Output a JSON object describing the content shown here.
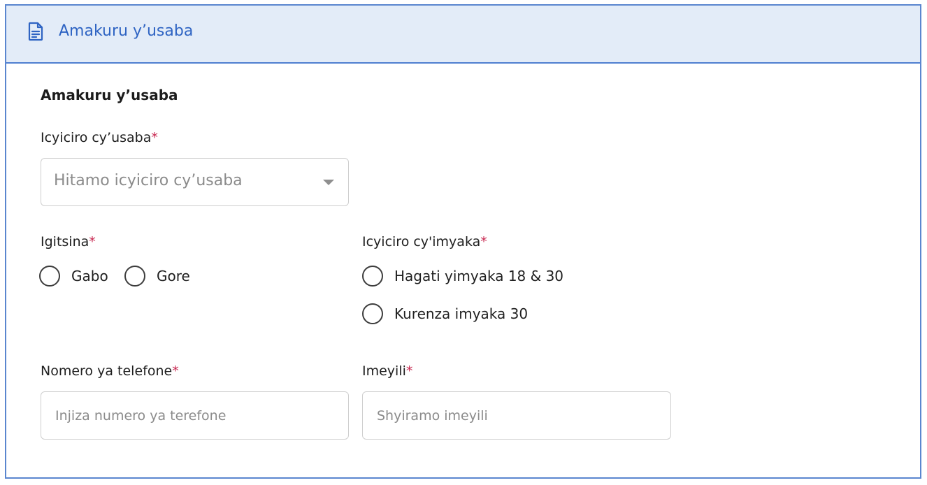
{
  "header": {
    "icon": "document-icon",
    "title": "Amakuru y’usaba"
  },
  "section": {
    "title": "Amakuru y’usaba"
  },
  "category": {
    "label": "Icyiciro cy’usaba",
    "required_mark": "*",
    "placeholder": "Hitamo icyiciro cy’usaba"
  },
  "gender": {
    "label": "Igitsina",
    "required_mark": "*",
    "options": [
      {
        "label": "Gabo",
        "selected": false
      },
      {
        "label": "Gore",
        "selected": false
      }
    ]
  },
  "age_group": {
    "label": "Icyiciro cy'imyaka",
    "required_mark": "*",
    "options": [
      {
        "label": "Hagati yimyaka 18 & 30",
        "selected": false
      },
      {
        "label": "Kurenza imyaka 30",
        "selected": false
      }
    ]
  },
  "phone": {
    "label": "Nomero ya telefone",
    "required_mark": "*",
    "placeholder": "Injiza numero ya terefone",
    "value": ""
  },
  "email": {
    "label": "Imeyili",
    "required_mark": "*",
    "placeholder": "Shyiramo imeyili",
    "value": ""
  },
  "colors": {
    "border_accent": "#5a86cf",
    "header_background": "#e3ecf8",
    "header_text": "#2f64c3",
    "required_mark": "#c7254e"
  }
}
